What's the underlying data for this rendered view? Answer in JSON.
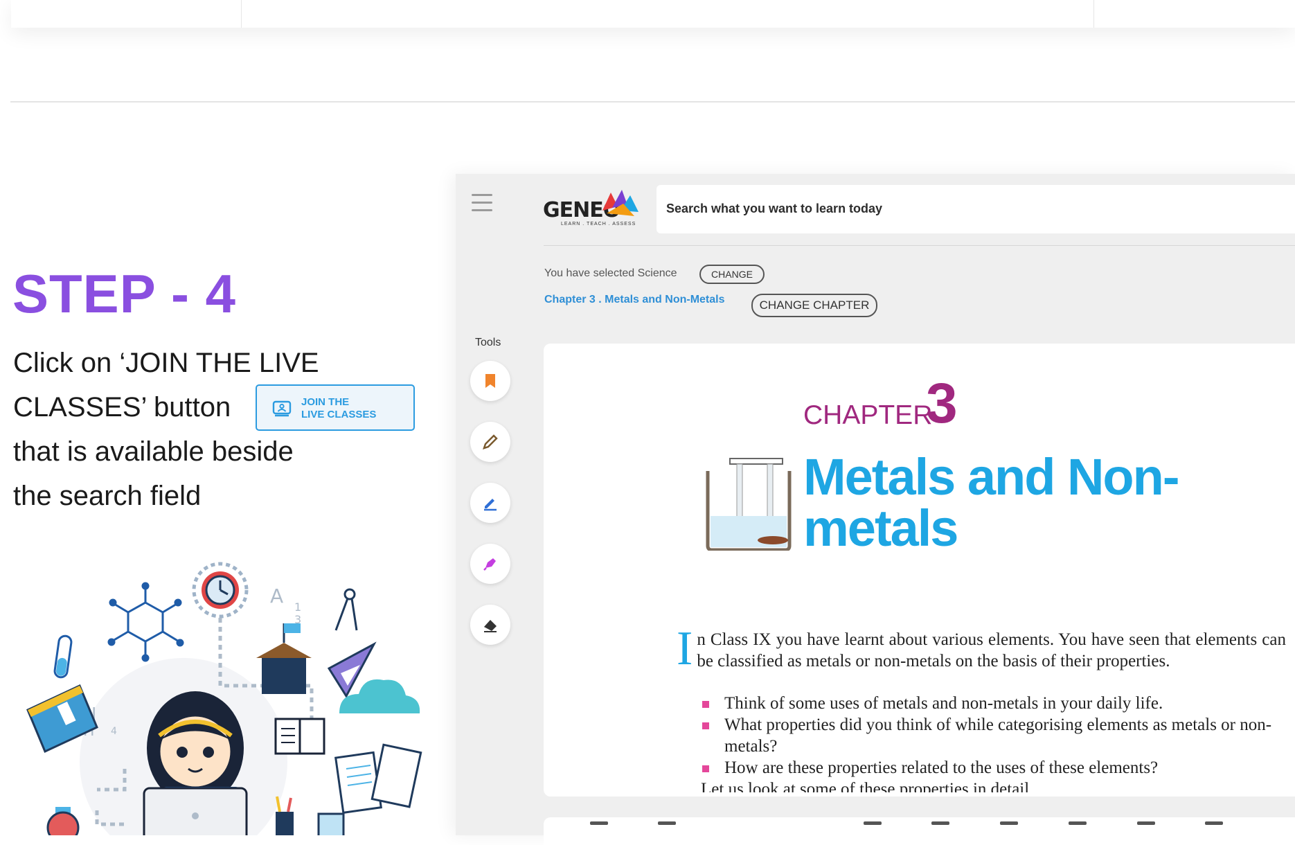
{
  "step": {
    "title": "STEP - 4",
    "desc_line1": "Click on ‘JOIN THE LIVE",
    "desc_line2": "CLASSES’ button",
    "desc_line3": " that is available beside",
    "desc_line4": "the search field",
    "join_button": {
      "line1": "JOIN THE",
      "line2": "LIVE CLASSES"
    }
  },
  "app": {
    "logo": "GENEO",
    "logo_tagline": "LEARN . TEACH . ASSESS",
    "search_placeholder": "Search what you want to learn today",
    "selected_subject_text": "You have selected Science",
    "change_label": "CHANGE",
    "chapter_link": "Chapter 3 . Metals and Non-Metals",
    "change_chapter_label": "CHANGE CHAPTER",
    "tools_label": "Tools",
    "tools": [
      {
        "icon": "bookmark-icon",
        "color": "#f0842c"
      },
      {
        "icon": "pencil-icon",
        "color": "#7a5a2e"
      },
      {
        "icon": "pen-icon",
        "color": "#2f6fd6"
      },
      {
        "icon": "highlighter-icon",
        "color": "#c43ee0"
      },
      {
        "icon": "eraser-icon",
        "color": "#333333"
      }
    ]
  },
  "document": {
    "chapter_word": "CHAPTER",
    "chapter_number": "3",
    "chapter_title": "Metals and Non-metals",
    "dropcap": "I",
    "intro": "n Class IX you have learnt about various elements. You have seen that elements can be classified as metals or non-metals on the basis of their properties.",
    "bullets": [
      "Think of some uses of metals and non-metals in your daily life.",
      "What properties did you think of while categorising elements as metals or non-metals?",
      "How are these properties related to the uses of these elements?"
    ],
    "cutoff_line": "Let us look at some of these properties in detail."
  },
  "colors": {
    "step_purple": "#8a4fe0",
    "accent_blue": "#2b9be0",
    "chapter_magenta": "#a0287f",
    "title_blue": "#1ea6e3"
  }
}
